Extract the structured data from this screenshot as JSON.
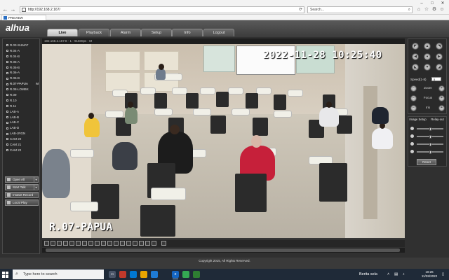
{
  "browser": {
    "url": "http://192.168.2.167/",
    "search_placeholder": "Search...",
    "tab_title": "PREVIEW"
  },
  "app": {
    "logo": "alhua",
    "nav": [
      "Live",
      "Playback",
      "Alarm",
      "Setup",
      "Info",
      "Logout"
    ],
    "active_nav": "Live"
  },
  "sidebar": {
    "channels": [
      "R.03-SUMAT",
      "R.04-A",
      "R.04-B",
      "R.05-A",
      "R.05-B",
      "R.06-A",
      "R.06-B",
      "R.07-PAPUA",
      "R.08-LOMBK",
      "R.09",
      "R.10",
      "R.11",
      "LAB-A",
      "LAB-B",
      "LAB-C",
      "LAB-D",
      "LAB-JRGN",
      "CAM 20",
      "CAM 21",
      "CAM 22"
    ],
    "selected_marker": "M",
    "buttons": {
      "open_all": "Open All",
      "start_talk": "Start Talk",
      "instant_record": "Instant Record",
      "local_play": "Local Play"
    }
  },
  "video": {
    "title": "192.168.2.167:8 - 1 - 91600ps - M",
    "timestamp": "2022-11-28 10:25:40",
    "camera_label": "R.07-PAPUA"
  },
  "ptz": {
    "speed_label": "Speed(1-8)",
    "speed_value": "5",
    "zoom": "Zoom",
    "focus": "Focus",
    "iris": "Iris",
    "minus": "−",
    "plus": "+"
  },
  "image_setup": {
    "tab_image": "Image Setup",
    "tab_relay": "Relay-out",
    "reset": "Reset",
    "levels": [
      0.5,
      0.5,
      0.5,
      0.5
    ]
  },
  "footer": "Copyright 2015, All Rights Reserved.",
  "taskbar": {
    "search_placeholder": "Type here to search",
    "news": "Berita sela",
    "time": "10:26",
    "date": "11/28/2022"
  }
}
